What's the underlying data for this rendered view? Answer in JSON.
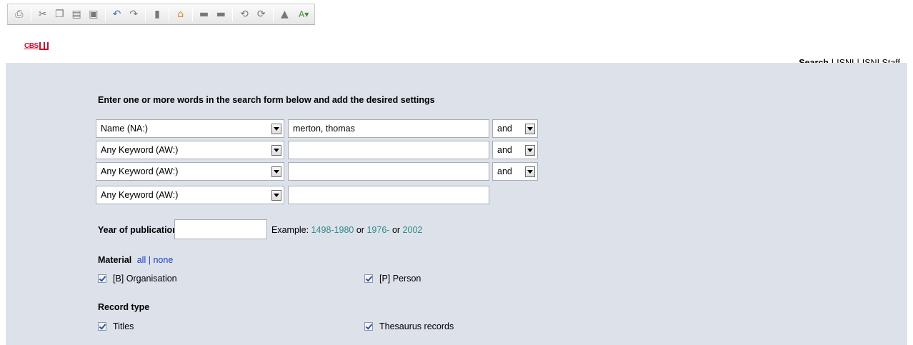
{
  "toolbar": {
    "icons": [
      "print-icon",
      "cut-icon",
      "copy-icon",
      "paste-icon",
      "save-icon",
      "undo-icon",
      "redo-icon",
      "document-icon",
      "home-icon",
      "previous-page-icon",
      "next-page-icon",
      "back-icon",
      "forward-icon",
      "up-icon",
      "font-dropdown-icon"
    ]
  },
  "header": {
    "logo_text": "CBS",
    "links": {
      "search": "Search",
      "isni": "ISNI",
      "isni_staff": "ISNI Staff",
      "separator": "|"
    }
  },
  "form": {
    "intro": "Enter one or more words in the search form below and add the desired settings",
    "rows": [
      {
        "field": "Name (NA:)",
        "value": "merton, thomas",
        "operator": "and"
      },
      {
        "field": "Any Keyword (AW:)",
        "value": "",
        "operator": "and"
      },
      {
        "field": "Any Keyword (AW:)",
        "value": "",
        "operator": "and"
      },
      {
        "field": "Any Keyword (AW:)",
        "value": ""
      }
    ],
    "year": {
      "label": "Year of publication",
      "value": "",
      "example_prefix": "Example:",
      "example_1": "1498-1980",
      "or_1": "or",
      "example_2": "1976-",
      "or_2": "or",
      "example_3": "2002"
    },
    "material": {
      "label": "Material",
      "all": "all",
      "separator": "|",
      "none": "none",
      "options": [
        {
          "label": "[B] Organisation",
          "checked": true
        },
        {
          "label": "[P] Person",
          "checked": true
        }
      ]
    },
    "record_type": {
      "label": "Record type",
      "options": [
        {
          "label": "Titles",
          "checked": true
        },
        {
          "label": "Thesaurus records",
          "checked": true
        }
      ]
    }
  }
}
